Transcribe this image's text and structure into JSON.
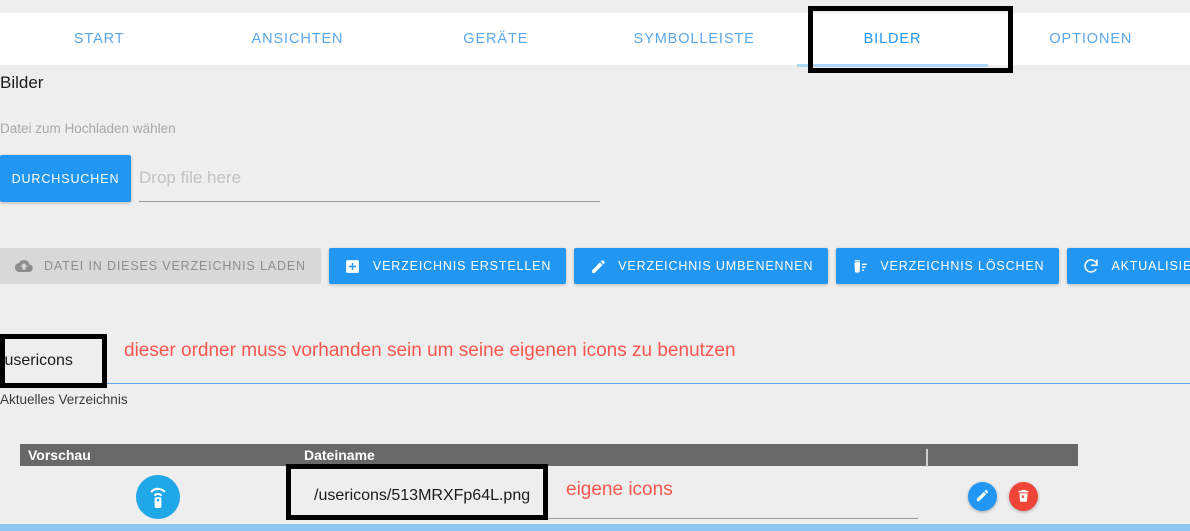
{
  "tabs": [
    {
      "label": "START",
      "active": false
    },
    {
      "label": "ANSICHTEN",
      "active": false
    },
    {
      "label": "GERÄTE",
      "active": false
    },
    {
      "label": "SYMBOLLEISTE",
      "active": false
    },
    {
      "label": "BILDER",
      "active": true
    },
    {
      "label": "OPTIONEN",
      "active": false
    }
  ],
  "page": {
    "title": "Bilder"
  },
  "upload": {
    "label": "Datei zum Hochladen wählen",
    "browse_button": "DURCHSUCHEN",
    "drop_placeholder": "Drop file here",
    "drop_value": ""
  },
  "toolbar": {
    "upload_to_dir": "DATEI IN DIESES VERZEICHNIS LADEN",
    "create_dir": "VERZEICHNIS ERSTELLEN",
    "rename_dir": "VERZEICHNIS UMBENENNEN",
    "delete_dir": "VERZEICHNIS LÖSCHEN",
    "refresh": "AKTUALISIEREN"
  },
  "directory": {
    "value": "/usericons",
    "hint": "Aktuelles Verzeichnis"
  },
  "table": {
    "columns": {
      "preview": "Vorschau",
      "filename": "Dateiname",
      "actions": ""
    },
    "rows": [
      {
        "preview_icon": "remote-control-icon",
        "filename": "/usericons/513MRXFp64L.png",
        "edit_label": "",
        "delete_label": ""
      }
    ]
  },
  "annotations": {
    "directory_note": "dieser ordner muss vorhanden sein um seine eigenen icons zu benutzen",
    "filename_note": "eigene icons"
  },
  "colors": {
    "accent_blue": "#2196f3",
    "tab_blue": "#5ba7e8",
    "annotation_red": "#f9564f",
    "delete_red": "#f04438",
    "header_gray": "#686868",
    "page_bg": "#eeeeee",
    "bottom_bar": "#8ec6f2"
  }
}
